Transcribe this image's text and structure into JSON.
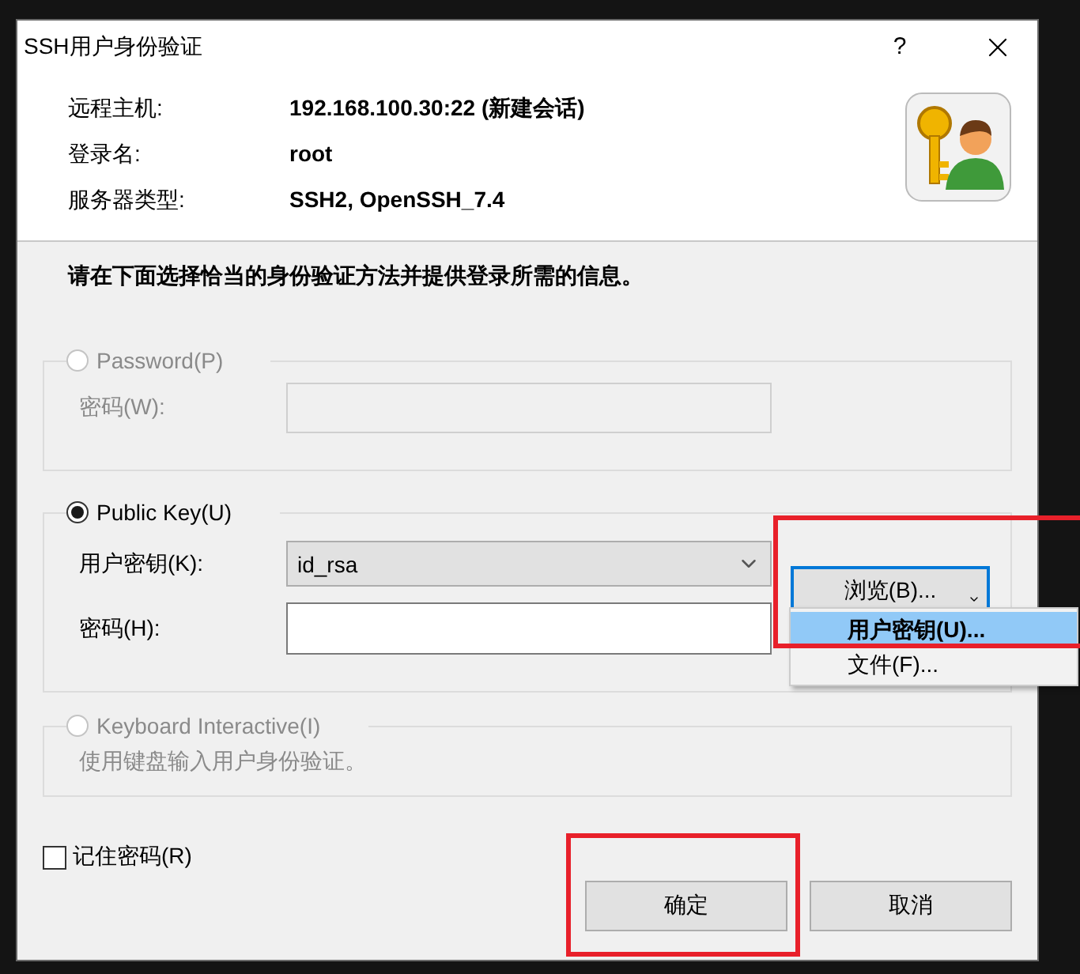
{
  "window": {
    "title": "SSH用户身份验证",
    "help": "?"
  },
  "info": [
    {
      "label": "远程主机:",
      "value": "192.168.100.30:22 (新建会话)"
    },
    {
      "label": "登录名:",
      "value": "root"
    },
    {
      "label": "服务器类型:",
      "value": "SSH2, OpenSSH_7.4"
    }
  ],
  "instruction": "请在下面选择恰当的身份验证方法并提供登录所需的信息。",
  "methods": [
    {
      "kind": "password",
      "label": "Password(P)",
      "selected": false,
      "disabled": true,
      "fields": [
        {
          "kind": "text",
          "label": "密码(W):"
        }
      ]
    },
    {
      "kind": "publickey",
      "label": "Public Key(U)",
      "selected": true,
      "disabled": false,
      "fields": [
        {
          "kind": "combo",
          "label": "用户密钥(K):",
          "value": "id_rsa"
        },
        {
          "kind": "text",
          "label": "密码(H):"
        }
      ],
      "browse_button": "浏览(B)...",
      "menu": [
        {
          "label": "用户密钥(U)...",
          "selected": true
        },
        {
          "label": "文件(F)...",
          "selected": false
        }
      ]
    },
    {
      "kind": "keyboard",
      "label": "Keyboard Interactive(I)",
      "selected": false,
      "disabled": true,
      "description": "使用键盘输入用户身份验证。"
    }
  ],
  "remember": {
    "label": "记住密码(R)",
    "checked": false
  },
  "buttons": [
    {
      "label": "确定"
    },
    {
      "label": "取消"
    }
  ]
}
